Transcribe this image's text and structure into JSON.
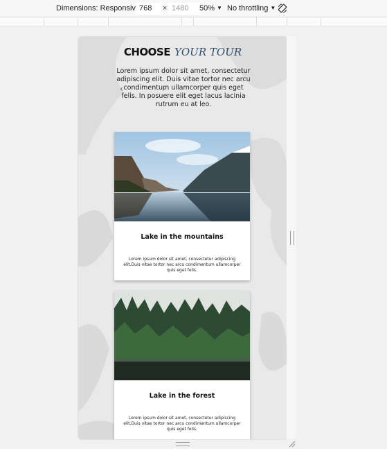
{
  "toolbar": {
    "dimensions_label": "Dimensions: Responsive",
    "width_value": "768",
    "times_sign": "×",
    "height_placeholder": "1480",
    "zoom": "50%",
    "throttling": "No throttling"
  },
  "page": {
    "heading_bold": "CHOOSE",
    "heading_script": "YOUR TOUR",
    "intro": "Lorem ipsum dolor sit amet, consectetur adipiscing elit. Duis vitae tortor nec arcu condimentum ullamcorper quis eget felis. In posuere elit eget lacus lacinia rutrum eu at leo.",
    "carousel_prev": "‹",
    "carousel_next": "›",
    "cards": [
      {
        "title": "Lake in the mountains",
        "description": "Lorem ipsum dolor sit amet, consectetur adipiscing elit.Duis vitae tortor nec arcu condimentum ullamcorper quis eget felis."
      },
      {
        "title": "Lake in the forest",
        "description": "Lorem ipsum dolor sit amet, consectetur adipiscing elit.Duis vitae tortor nec arcu condimentum ullamcorper quis eget felis."
      }
    ]
  },
  "colors": {
    "heading_script": "#2f4f6b",
    "toolbar_bg": "#f7f7f7",
    "viewport_bg": "#e6e6e6"
  },
  "icons": {
    "rotate": "rotate-icon",
    "caret": "caret-down-icon"
  }
}
